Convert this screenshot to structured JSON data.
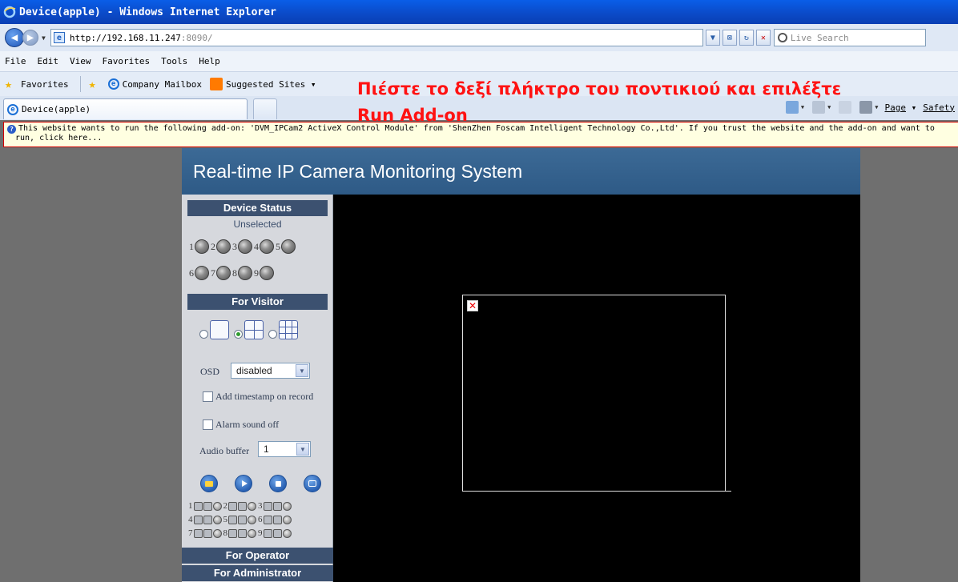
{
  "window": {
    "title": "Device(apple) - Windows Internet Explorer"
  },
  "address": {
    "url_host": "http://192.168.11.247",
    "url_port": ":8090/",
    "search_placeholder": "Live Search"
  },
  "menu": [
    "File",
    "Edit",
    "View",
    "Favorites",
    "Tools",
    "Help"
  ],
  "favorites_bar": {
    "favorites_label": "Favorites",
    "items": [
      "Company Mailbox",
      "Suggested Sites ▾"
    ]
  },
  "tab": {
    "title": "Device(apple)"
  },
  "command_bar": {
    "page_label": "Page",
    "safety_label": "Safety"
  },
  "info_bar": {
    "line1": "This website wants to run the following add-on: 'DVM_IPCam2 ActiveX Control Module' from 'ShenZhen Foscam Intelligent Technology Co.,Ltd'. If you trust the website and the add-on and want to",
    "line2": "run, click here..."
  },
  "annotation": {
    "line1": "Πιέστε το δεξί πλήκτρο του ποντικιού και επιλέξτε",
    "line2": "Run Add-on",
    "color": "#ff1212"
  },
  "camera_page": {
    "header": "Real-time IP Camera Monitoring System",
    "device_status_title": "Device Status",
    "device_status_value": "Unselected",
    "device_numbers_row1": [
      "1",
      "2",
      "3",
      "4",
      "5"
    ],
    "device_numbers_row2": [
      "6",
      "7",
      "8",
      "9"
    ],
    "for_visitor_title": "For Visitor",
    "osd_label": "OSD",
    "osd_value": "disabled",
    "timestamp_label": "Add timestamp on record",
    "alarm_label": "Alarm sound off",
    "audio_buffer_label": "Audio buffer",
    "audio_buffer_value": "1",
    "channel_numbers": [
      [
        "1",
        "2",
        "3"
      ],
      [
        "4",
        "5",
        "6"
      ],
      [
        "7",
        "8",
        "9"
      ]
    ],
    "for_operator_title": "For Operator",
    "for_administrator_title": "For Administrator"
  },
  "colors": {
    "titlebar": "#0b49c6",
    "camera_header": "#35628e",
    "panel_header": "#3c5170",
    "video_background": "#000000"
  }
}
